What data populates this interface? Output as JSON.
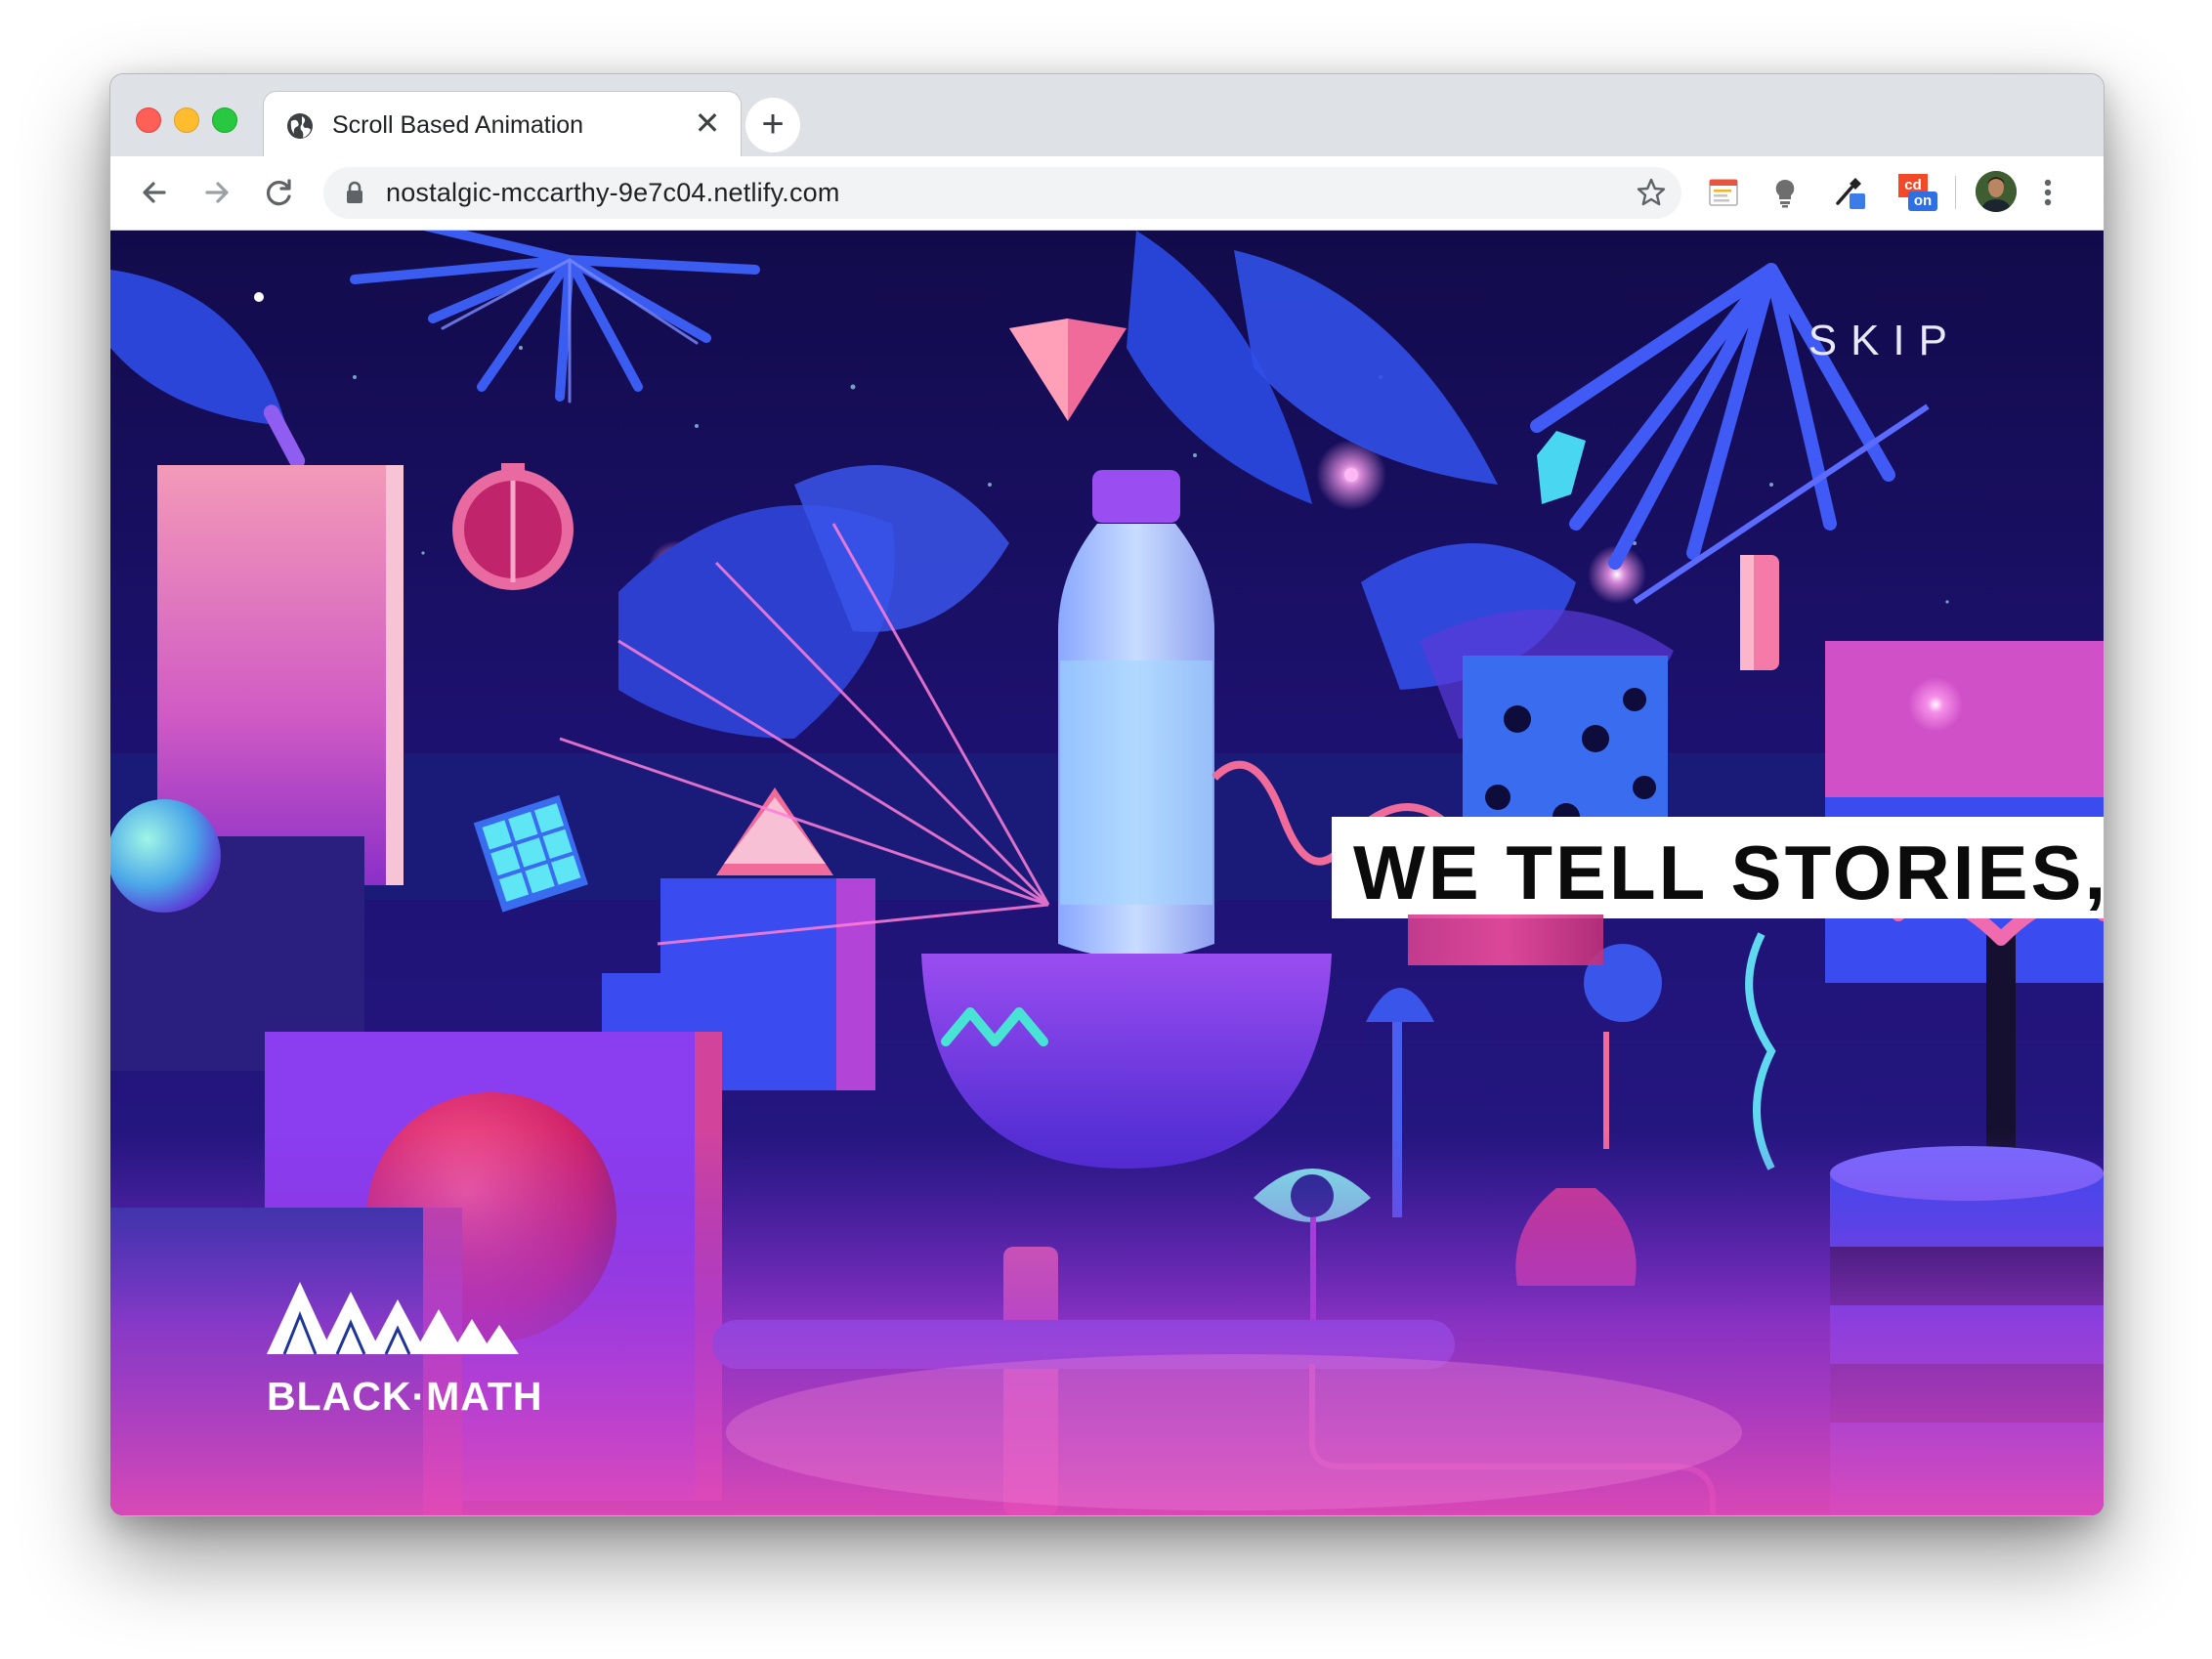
{
  "browser": {
    "tab": {
      "title": "Scroll Based Animation",
      "close_glyph": "✕"
    },
    "new_tab_glyph": "+",
    "address_bar": {
      "url": "nostalgic-mccarthy-9e7c04.netlify.com"
    },
    "nav_icons": [
      "back-arrow-icon",
      "forward-arrow-icon",
      "reload-icon"
    ],
    "extensions": [
      "notes-extension-icon",
      "lightbulb-extension-icon",
      "eyedropper-extension-icon",
      "cssd-on-extension-icon",
      "profile-avatar",
      "more-menu-icon"
    ],
    "extension_badge": "on",
    "extension_label": "cd"
  },
  "page": {
    "skip_label": "SKIP",
    "headline": "WE TELL STORIES,",
    "logo_text": "BLACK·MATH"
  },
  "colors": {
    "scene_bg": "#1a0f5e",
    "accent_pink": "#f04d9c",
    "accent_blue": "#3a4cf0",
    "accent_teal": "#49e3d6"
  }
}
